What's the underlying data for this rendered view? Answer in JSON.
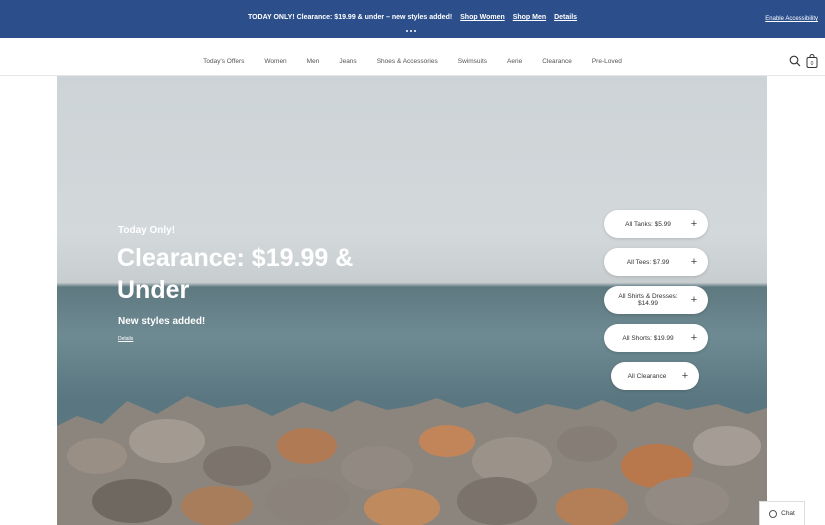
{
  "promo": {
    "message": "TODAY ONLY! Clearance: $19.99 & under – new styles added!",
    "links": [
      "Shop Women",
      "Shop Men",
      "Details"
    ],
    "accessibility": "Enable Accessibility"
  },
  "nav": {
    "items": [
      "Today's Offers",
      "Women",
      "Men",
      "Jeans",
      "Shoes & Accessories",
      "Swimsuits",
      "Aerie",
      "Clearance",
      "Pre-Loved"
    ],
    "bag_count": "0",
    "icons": [
      "search-icon",
      "shopping-bag-icon"
    ]
  },
  "hero": {
    "kicker": "Today Only!",
    "title": "Clearance: $19.99 & Under",
    "subtitle": "New styles added!",
    "details": "Details",
    "pills": [
      {
        "label": "All Tanks: $5.99"
      },
      {
        "label": "All Tees: $7.99"
      },
      {
        "label": "All Shirts & Dresses: $14.99"
      },
      {
        "label": "All Shorts: $19.99"
      },
      {
        "label": "All Clearance"
      }
    ]
  },
  "chat": {
    "label": "Chat"
  },
  "colors": {
    "banner": "#2c4f8c",
    "text": "#333333",
    "white": "#ffffff"
  }
}
